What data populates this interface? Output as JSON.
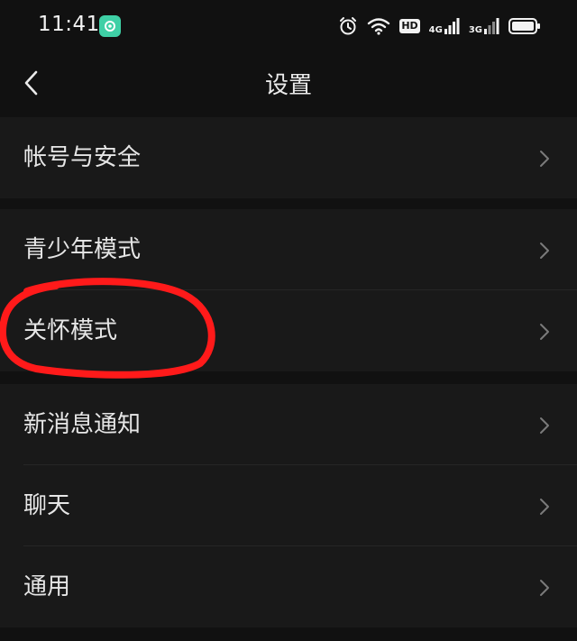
{
  "status_bar": {
    "time": "11:41",
    "hd": "HD",
    "network_1": "4G",
    "network_2": "3G",
    "icons": [
      "app-badge-icon",
      "alarm-icon",
      "wifi-icon",
      "signal-icon",
      "battery-icon"
    ]
  },
  "header": {
    "title": "设置",
    "back_icon": "chevron-left-icon"
  },
  "groups": [
    {
      "items": [
        {
          "label": "帐号与安全"
        }
      ]
    },
    {
      "items": [
        {
          "label": "青少年模式"
        },
        {
          "label": "关怀模式"
        }
      ]
    },
    {
      "items": [
        {
          "label": "新消息通知"
        },
        {
          "label": "聊天"
        },
        {
          "label": "通用"
        }
      ]
    }
  ],
  "colors": {
    "background": "#111111",
    "row_background": "#191919",
    "annotation": "#ff1a1a"
  }
}
